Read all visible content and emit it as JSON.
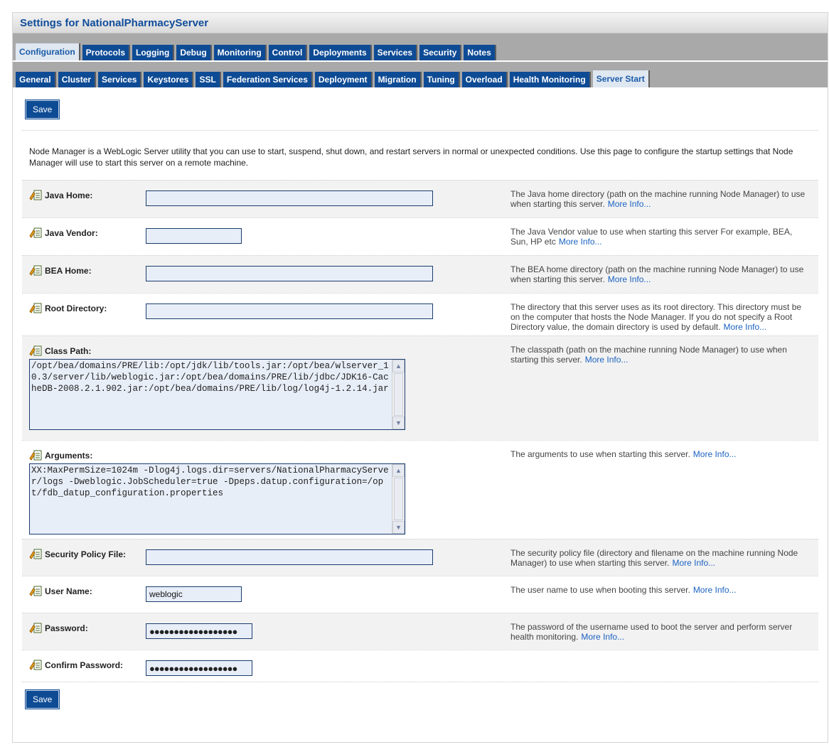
{
  "title": "Settings for NationalPharmacyServer",
  "tabs_main": [
    {
      "label": "Configuration",
      "active": true
    },
    {
      "label": "Protocols"
    },
    {
      "label": "Logging"
    },
    {
      "label": "Debug"
    },
    {
      "label": "Monitoring"
    },
    {
      "label": "Control"
    },
    {
      "label": "Deployments"
    },
    {
      "label": "Services"
    },
    {
      "label": "Security"
    },
    {
      "label": "Notes"
    }
  ],
  "tabs_sub": [
    {
      "label": "General"
    },
    {
      "label": "Cluster"
    },
    {
      "label": "Services"
    },
    {
      "label": "Keystores"
    },
    {
      "label": "SSL"
    },
    {
      "label": "Federation Services"
    },
    {
      "label": "Deployment"
    },
    {
      "label": "Migration"
    },
    {
      "label": "Tuning"
    },
    {
      "label": "Overload"
    },
    {
      "label": "Health Monitoring"
    },
    {
      "label": "Server Start",
      "active": true
    }
  ],
  "save_label": "Save",
  "intro": "Node Manager is a WebLogic Server utility that you can use to start, suspend, shut down, and restart servers in normal or unexpected conditions. Use this page to configure the startup settings that Node Manager will use to start this server on a remote machine.",
  "more_info": "More Info...",
  "fields": {
    "java_home": {
      "label": "Java Home:",
      "value": "",
      "help": "The Java home directory (path on the machine running Node Manager) to use when starting this server."
    },
    "java_vendor": {
      "label": "Java Vendor:",
      "value": "",
      "help": "The Java Vendor value to use when starting this server For example, BEA, Sun, HP etc"
    },
    "bea_home": {
      "label": "BEA Home:",
      "value": "",
      "help": "The BEA home directory (path on the machine running Node Manager) to use when starting this server."
    },
    "root_directory": {
      "label": "Root Directory:",
      "value": "",
      "help": "The directory that this server uses as its root directory. This directory must be on the computer that hosts the Node Manager. If you do not specify a Root Directory value, the domain directory is used by default."
    },
    "class_path": {
      "label": "Class Path:",
      "value": "/opt/bea/domains/PRE/lib:/opt/jdk/lib/tools.jar:/opt/bea/wlserver_10.3/server/lib/weblogic.jar:/opt/bea/domains/PRE/lib/jdbc/JDK16-CacheDB-2008.2.1.902.jar:/opt/bea/domains/PRE/lib/log/log4j-1.2.14.jar",
      "help": "The classpath (path on the machine running Node Manager) to use when starting this server."
    },
    "arguments": {
      "label": "Arguments:",
      "value": "XX:MaxPermSize=1024m -Dlog4j.logs.dir=servers/NationalPharmacyServer/logs -Dweblogic.JobScheduler=true -Dpeps.datup.configuration=/opt/fdb_datup_configuration.properties",
      "help": "The arguments to use when starting this server."
    },
    "security_policy_file": {
      "label": "Security Policy File:",
      "value": "",
      "help": "The security policy file (directory and filename on the machine running Node Manager) to use when starting this server."
    },
    "user_name": {
      "label": "User Name:",
      "value": "weblogic",
      "help": "The user name to use when booting this server."
    },
    "password": {
      "label": "Password:",
      "masked": "●●●●●●●●●●●●●●●●●●",
      "help": "The password of the username used to boot the server and perform server health monitoring."
    },
    "confirm_password": {
      "label": "Confirm Password:",
      "masked": "●●●●●●●●●●●●●●●●●●"
    }
  },
  "colors": {
    "tab_bg": "#0e4b95",
    "tab_active_bg": "#dfe7f1",
    "title": "#0f4c99",
    "link": "#1c63c2"
  }
}
